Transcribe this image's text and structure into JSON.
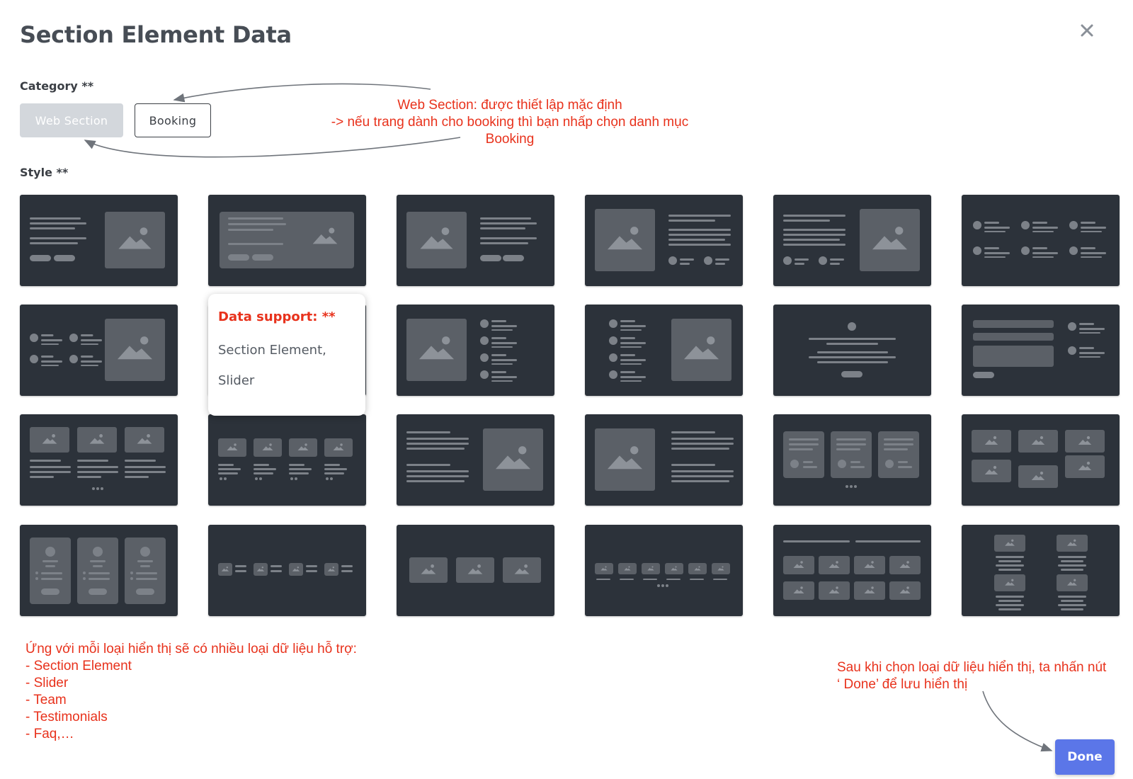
{
  "modal": {
    "title": "Section Element Data",
    "close_label": "×"
  },
  "category": {
    "label": "Category **",
    "options": [
      {
        "label": "Web Section",
        "selected": true
      },
      {
        "label": "Booking",
        "selected": false
      }
    ]
  },
  "style": {
    "label": "Style **"
  },
  "tooltip": {
    "title": "Data support: **",
    "items": [
      "Section Element,",
      "Slider"
    ]
  },
  "annotations": {
    "category_note": [
      "Web Section: được thiết lập mặc định",
      "-> nếu trang dành cho booking thì bạn nhấp chọn danh mục",
      "Booking"
    ],
    "data_types_note": [
      "Ứng với mỗi loại hiển thị sẽ có nhiều loại dữ liệu hỗ trợ:",
      "- Section Element",
      "- Slider",
      "- Team",
      "- Testimonials",
      "- Faq,…"
    ],
    "done_note": [
      "Sau khi chọn loại dữ liệu hiển thị, ta nhấn nút",
      "‘ Done’ để lưu hiển thị"
    ]
  },
  "actions": {
    "done_label": "Done"
  },
  "colors": {
    "tile_bg": "#2c323a",
    "tile_shape": "#5b6067",
    "tile_line": "#7c8188",
    "annotation": "#e8321c",
    "primary": "#5b76e8",
    "selected_category": "#d3d7dc"
  }
}
